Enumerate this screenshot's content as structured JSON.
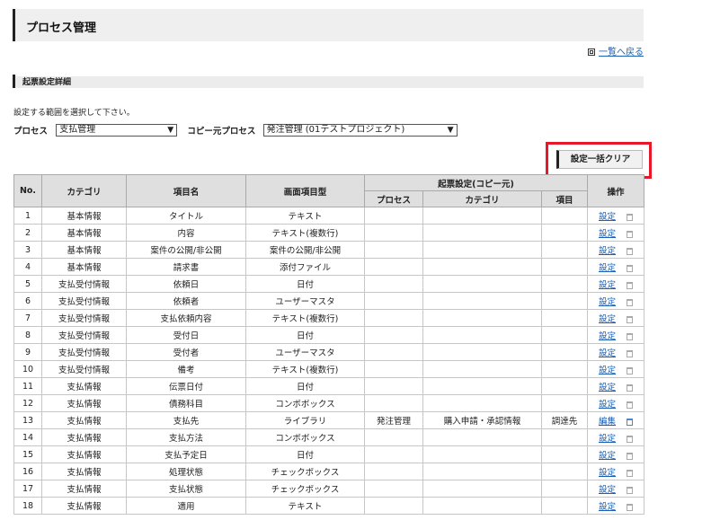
{
  "page": {
    "title": "プロセス管理",
    "back_link": "一覧へ戻る",
    "section_title": "起票設定詳細",
    "instruction": "設定する範囲を選択して下さい。"
  },
  "selectors": {
    "process_label": "プロセス",
    "process_value": "支払管理",
    "copy_source_label": "コピー元プロセス",
    "copy_source_value": "発注管理 (01テストプロジェクト)"
  },
  "clear_button": "設定一括クリア",
  "table": {
    "headers": {
      "no": "No.",
      "category": "カテゴリ",
      "item_name": "項目名",
      "screen_item_type": "画面項目型",
      "copy_setting": "起票設定(コピー元)",
      "process": "プロセス",
      "sub_category": "カテゴリ",
      "item": "項目",
      "operation": "操作"
    },
    "rows": [
      {
        "no": "1",
        "category": "基本情報",
        "name": "タイトル",
        "type": "テキスト",
        "process": "",
        "sub_category": "",
        "item": "",
        "op": "設定"
      },
      {
        "no": "2",
        "category": "基本情報",
        "name": "内容",
        "type": "テキスト(複数行)",
        "process": "",
        "sub_category": "",
        "item": "",
        "op": "設定"
      },
      {
        "no": "3",
        "category": "基本情報",
        "name": "案件の公開/非公開",
        "type": "案件の公開/非公開",
        "process": "",
        "sub_category": "",
        "item": "",
        "op": "設定"
      },
      {
        "no": "4",
        "category": "基本情報",
        "name": "請求書",
        "type": "添付ファイル",
        "process": "",
        "sub_category": "",
        "item": "",
        "op": "設定"
      },
      {
        "no": "5",
        "category": "支払受付情報",
        "name": "依頼日",
        "type": "日付",
        "process": "",
        "sub_category": "",
        "item": "",
        "op": "設定"
      },
      {
        "no": "6",
        "category": "支払受付情報",
        "name": "依頼者",
        "type": "ユーザーマスタ",
        "process": "",
        "sub_category": "",
        "item": "",
        "op": "設定"
      },
      {
        "no": "7",
        "category": "支払受付情報",
        "name": "支払依頼内容",
        "type": "テキスト(複数行)",
        "process": "",
        "sub_category": "",
        "item": "",
        "op": "設定"
      },
      {
        "no": "8",
        "category": "支払受付情報",
        "name": "受付日",
        "type": "日付",
        "process": "",
        "sub_category": "",
        "item": "",
        "op": "設定"
      },
      {
        "no": "9",
        "category": "支払受付情報",
        "name": "受付者",
        "type": "ユーザーマスタ",
        "process": "",
        "sub_category": "",
        "item": "",
        "op": "設定"
      },
      {
        "no": "10",
        "category": "支払受付情報",
        "name": "備考",
        "type": "テキスト(複数行)",
        "process": "",
        "sub_category": "",
        "item": "",
        "op": "設定"
      },
      {
        "no": "11",
        "category": "支払情報",
        "name": "伝票日付",
        "type": "日付",
        "process": "",
        "sub_category": "",
        "item": "",
        "op": "設定"
      },
      {
        "no": "12",
        "category": "支払情報",
        "name": "債務科目",
        "type": "コンボボックス",
        "process": "",
        "sub_category": "",
        "item": "",
        "op": "設定"
      },
      {
        "no": "13",
        "category": "支払情報",
        "name": "支払先",
        "type": "ライブラリ",
        "process": "発注管理",
        "sub_category": "購入申請・承認情報",
        "item": "調達先",
        "op": "編集",
        "active": true
      },
      {
        "no": "14",
        "category": "支払情報",
        "name": "支払方法",
        "type": "コンボボックス",
        "process": "",
        "sub_category": "",
        "item": "",
        "op": "設定"
      },
      {
        "no": "15",
        "category": "支払情報",
        "name": "支払予定日",
        "type": "日付",
        "process": "",
        "sub_category": "",
        "item": "",
        "op": "設定"
      },
      {
        "no": "16",
        "category": "支払情報",
        "name": "処理状態",
        "type": "チェックボックス",
        "process": "",
        "sub_category": "",
        "item": "",
        "op": "設定"
      },
      {
        "no": "17",
        "category": "支払情報",
        "name": "支払状態",
        "type": "チェックボックス",
        "process": "",
        "sub_category": "",
        "item": "",
        "op": "設定"
      },
      {
        "no": "18",
        "category": "支払情報",
        "name": "適用",
        "type": "テキスト",
        "process": "",
        "sub_category": "",
        "item": "",
        "op": "設定"
      }
    ]
  },
  "icons": {
    "back": "square-bullet-icon",
    "select": "chevron-down-icon",
    "delete": "trash-icon"
  },
  "colors": {
    "link": "#1a5fb4",
    "highlight": "#e8182b",
    "header_bg": "#dfdfdf"
  }
}
